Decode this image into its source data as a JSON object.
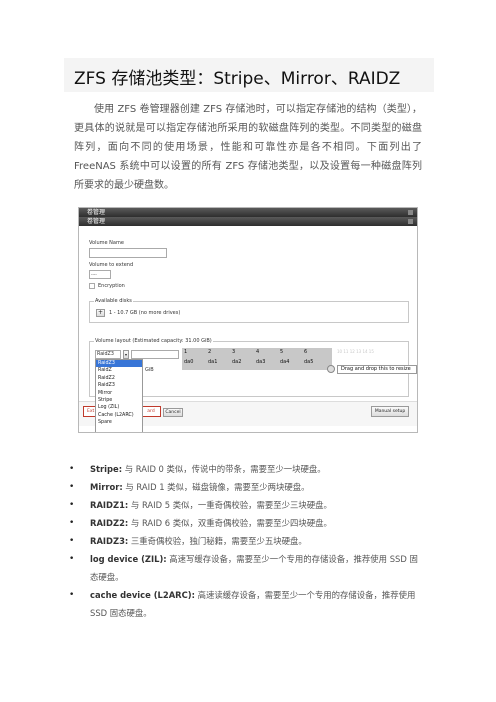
{
  "doc": {
    "title": "ZFS 存储池类型：Stripe、Mirror、RAIDZ",
    "intro": "使用 ZFS 卷管理器创建 ZFS 存储池时，可以指定存储池的结构（类型），更具体的说就是可以指定存储池所采用的软磁盘阵列的类型。不同类型的磁盘阵列，面向不同的使用场景，性能和可靠性亦是各不相同。下面列出了 FreeNAS 系统中可以设置的所有 ZFS 存储池类型，以及设置每一种磁盘阵列所要求的最少硬盘数。"
  },
  "screenshot": {
    "bar1": "卷管理",
    "bar2": "卷管理",
    "volume_name_label": "Volume Name",
    "volume_extend_label": "Volume to extend",
    "extend_value": "----",
    "encryption_label": "Encryption",
    "available_disks_legend": "Available disks",
    "available_disks_value": "1 - 10.7 GB (no more drives)",
    "layout_legend": "Volume layout (Estimated capacity: 31.00 GiB)",
    "layout_select": "RaidZ3",
    "column_numbers": [
      "1",
      "2",
      "3",
      "4",
      "5",
      "6"
    ],
    "disk_names": [
      "da0",
      "da1",
      "da2",
      "da3",
      "da4",
      "da5"
    ],
    "faint_numbers": "10 11 12 13 14 15",
    "size_fragment": "GiB",
    "tooltip": "Drag and drop this to resize",
    "dropdown_options": [
      "RaidZ3",
      "RaidZ",
      "RaidZ2",
      "RaidZ3",
      "Mirror",
      "Stripe",
      "Log (ZIL)",
      "Cache (L2ARC)",
      "Spare"
    ],
    "add_extra_button": "Ext",
    "add_volume_button": "ard",
    "cancel_button": "Cancel",
    "manual_setup_button": "Manual setup"
  },
  "types": [
    {
      "term": "Stripe:",
      "desc": " 与 RAID 0 类似，传说中的带条，需要至少一块硬盘。"
    },
    {
      "term": "Mirror:",
      "desc": " 与 RAID 1 类似，磁盘镜像，需要至少两块硬盘。"
    },
    {
      "term": "RAIDZ1:",
      "desc": " 与 RAID 5 类似，一重奇偶校验，需要至少三块硬盘。"
    },
    {
      "term": "RAIDZ2:",
      "desc": " 与 RAID 6 类似，双重奇偶校验，需要至少四块硬盘。"
    },
    {
      "term": "RAIDZ3:",
      "desc": " 三重奇偶校验，独门秘籍，需要至少五块硬盘。"
    },
    {
      "term": "log device (ZIL):",
      "desc": " 高速写缓存设备，需要至少一个专用的存储设备，推荐使用 SSD 固",
      "desc2": "态硬盘。"
    },
    {
      "term": "cache device (L2ARC):",
      "desc": " 高速读缓存设备，需要至少一个专用的存储设备，推荐使用",
      "desc2": "SSD 固态硬盘。"
    }
  ]
}
